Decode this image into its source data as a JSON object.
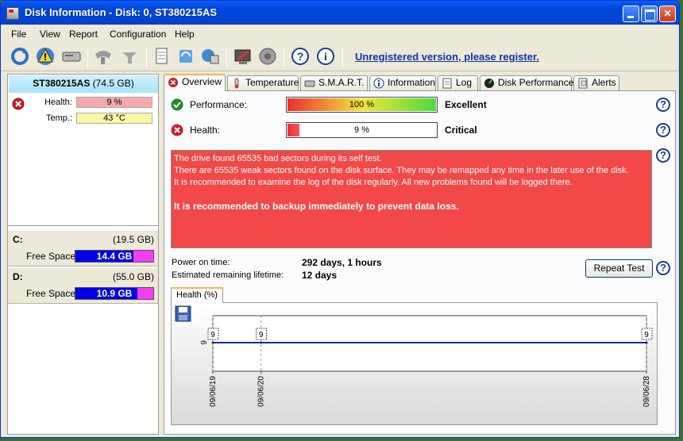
{
  "window": {
    "title": "Disk Information - Disk: 0, ST380215AS"
  },
  "menu": [
    "File",
    "View",
    "Report",
    "Configuration",
    "Help"
  ],
  "toolbar": {
    "register_link": "Unregistered version, please register."
  },
  "sidebar": {
    "disk_model": "ST380215AS",
    "disk_size": "(74.5 GB)",
    "health_label": "Health:",
    "health_value": "9 %",
    "temp_label": "Temp.:",
    "temp_value": "43 °C",
    "volumes": [
      {
        "letter": "C:",
        "size": "(19.5 GB)",
        "free_label": "Free Space",
        "free_value": "14.4 GB",
        "free_fraction": 0.74
      },
      {
        "letter": "D:",
        "size": "(55.0 GB)",
        "free_label": "Free Space",
        "free_value": "10.9 GB",
        "free_fraction": 0.8
      }
    ]
  },
  "tabs": [
    "Overview",
    "Temperature",
    "S.M.A.R.T.",
    "Information",
    "Log",
    "Disk Performance",
    "Alerts"
  ],
  "overview": {
    "performance_label": "Performance:",
    "performance_value": "100 %",
    "performance_percent": 100,
    "performance_status": "Excellent",
    "health_label": "Health:",
    "health_value": "9 %",
    "health_percent": 9,
    "health_status": "Critical",
    "message_lines": [
      "The drive found 65535 bad sectors during its self test.",
      "There are 65535 weak sectors found on the disk surface. They may be remapped any time in the later use of the disk.",
      "It is recommended to examine the log of the disk regularly. All new problems found will be logged there."
    ],
    "message_warning": "It is recommended to backup immediately to prevent data loss.",
    "power_on_label": "Power on time:",
    "power_on_value": "292 days, 1 hours",
    "lifetime_label": "Estimated remaining lifetime:",
    "lifetime_value": "12 days",
    "repeat_button": "Repeat Test",
    "chart_tab": "Health (%)"
  },
  "colors": {
    "accent": "#0046d8",
    "critical": "#f24848",
    "free_space": "#0000e8",
    "used_space": "#f33ef3"
  },
  "chart_data": {
    "type": "line",
    "x": [
      "09/06/19",
      "09/06/20",
      "09/06/28"
    ],
    "values": [
      9,
      9,
      9
    ],
    "y_tick": "9",
    "data_labels": [
      "9",
      "9",
      "9"
    ]
  }
}
